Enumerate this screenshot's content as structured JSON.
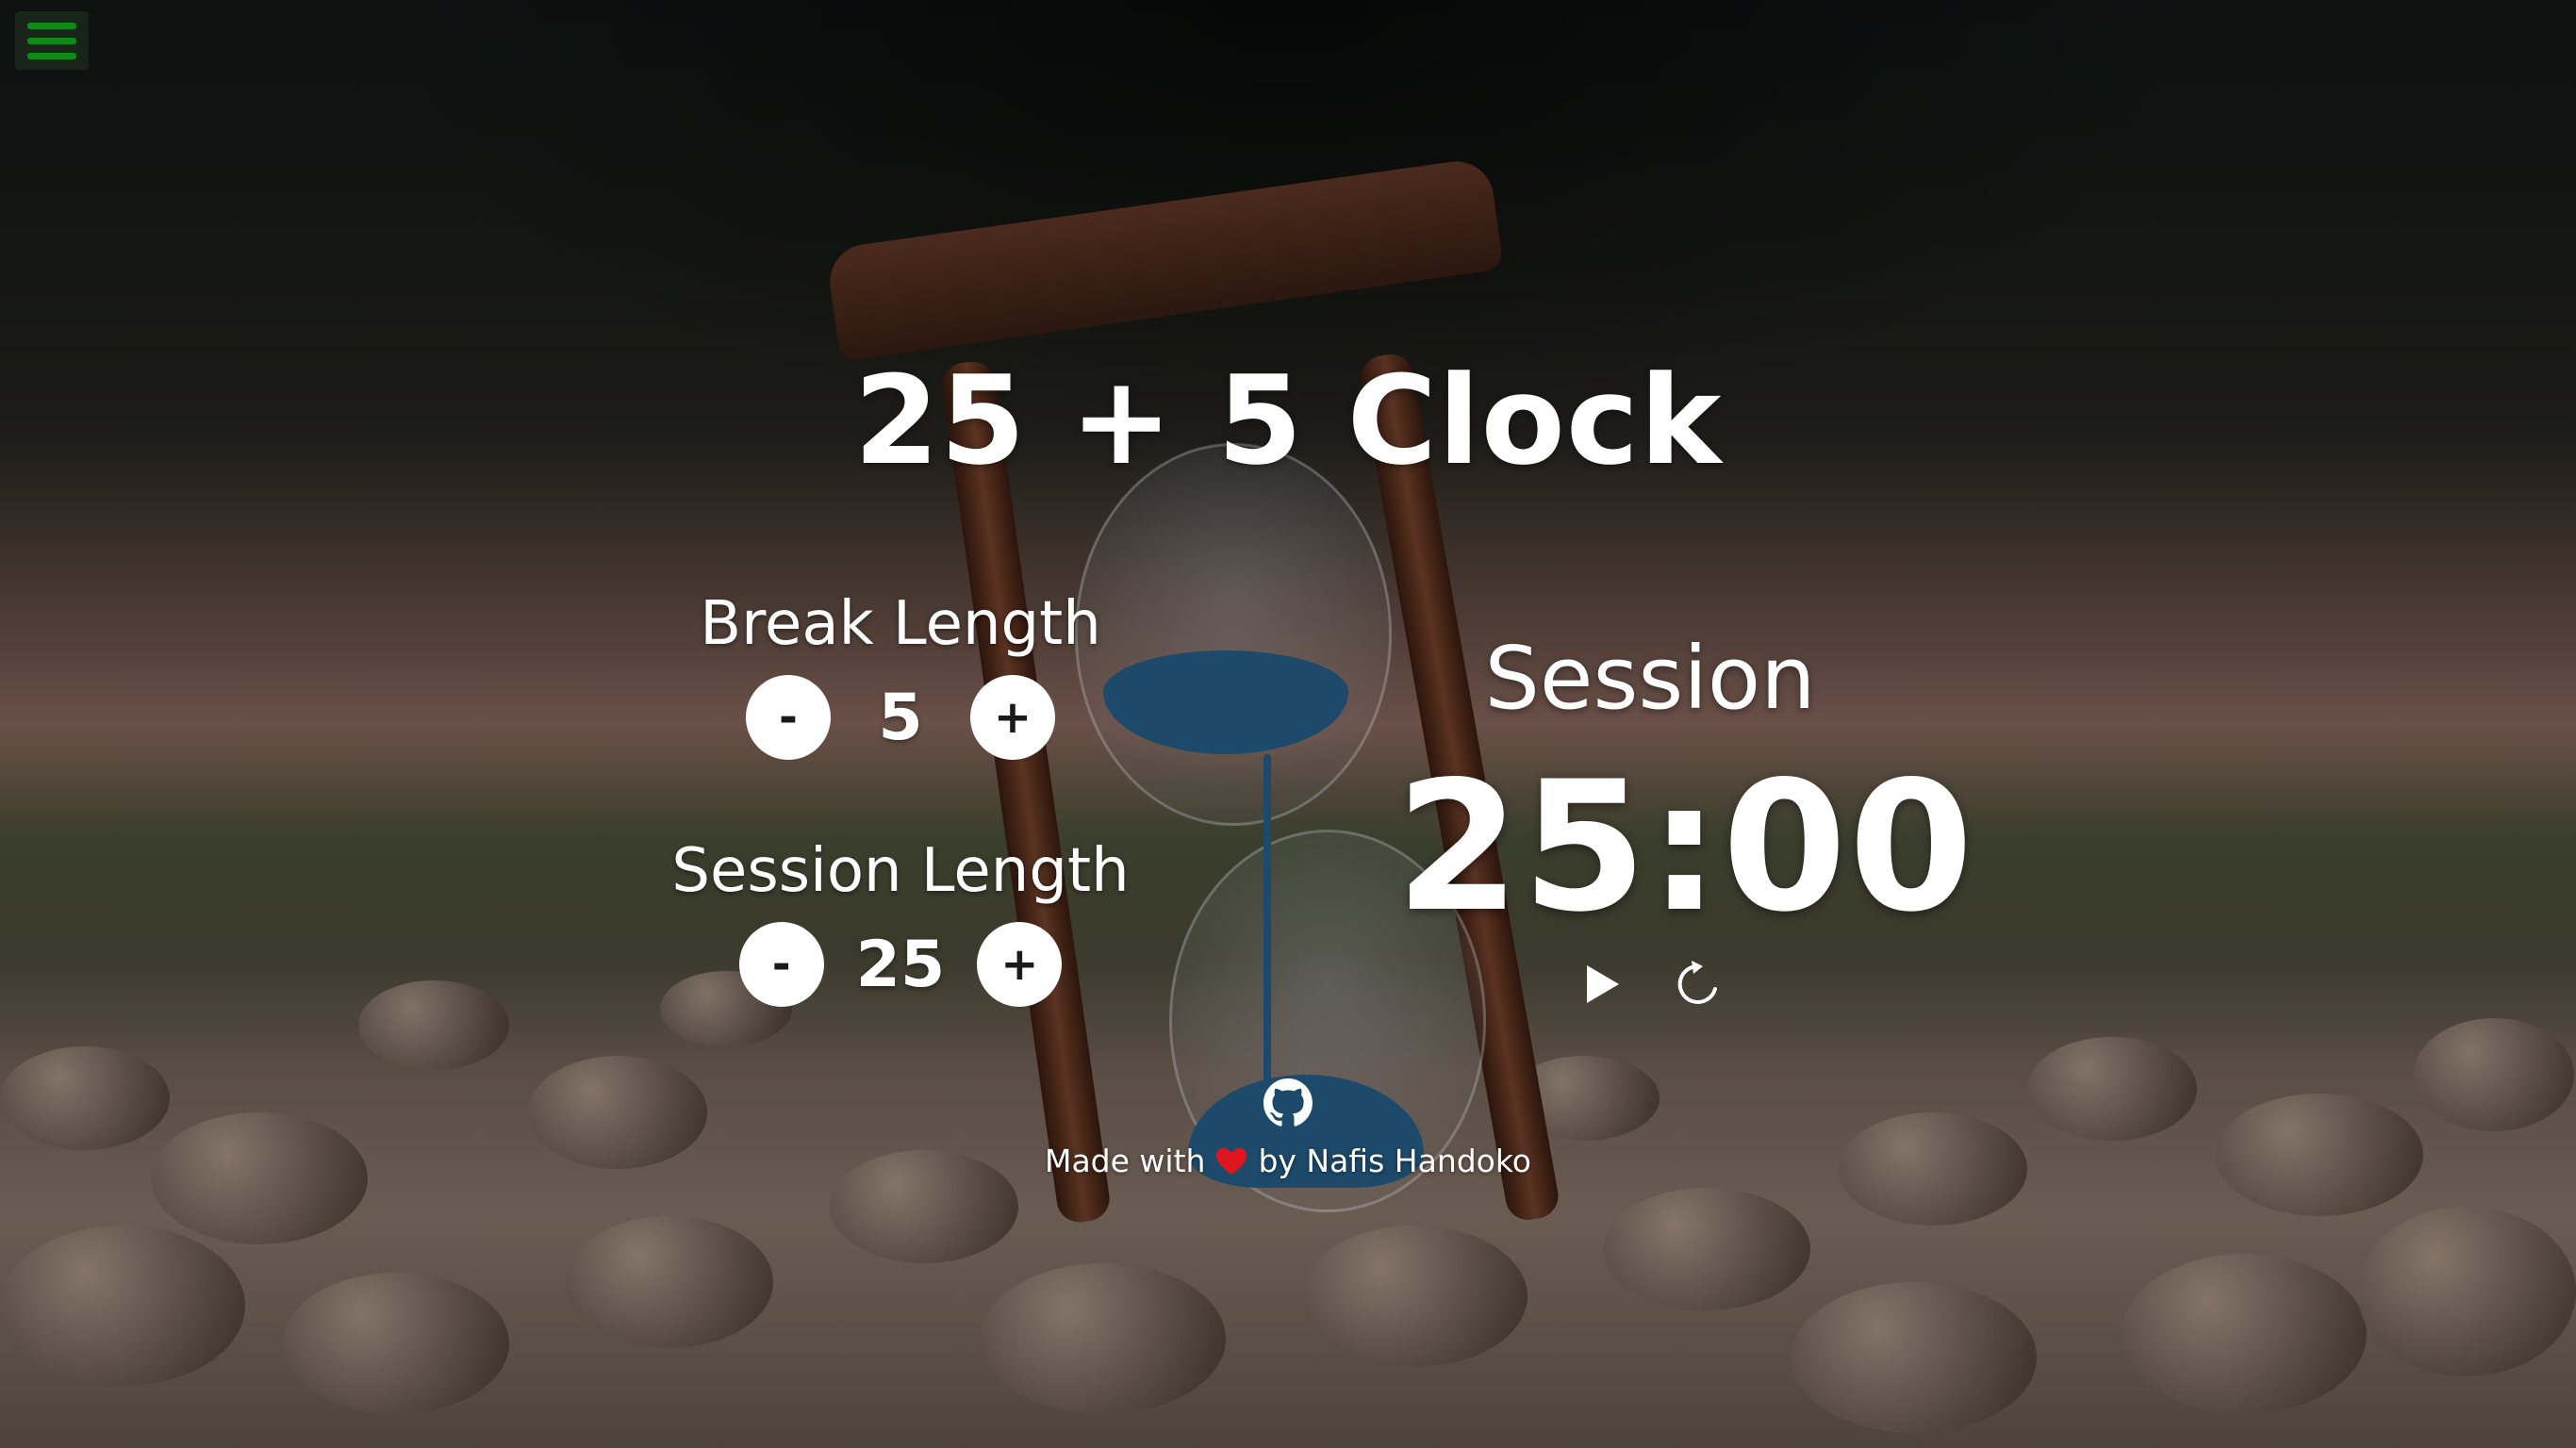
{
  "app": {
    "title": "25 + 5 Clock"
  },
  "menu": {
    "icon": "hamburger-menu-icon",
    "color": "#0f8a16"
  },
  "break_control": {
    "label": "Break Length",
    "decrement_label": "-",
    "value": "5",
    "increment_label": "+"
  },
  "session_control": {
    "label": "Session Length",
    "decrement_label": "-",
    "value": "25",
    "increment_label": "+"
  },
  "timer": {
    "label": "Session",
    "display": "25:00",
    "play_icon": "play-icon",
    "reset_icon": "reset-icon"
  },
  "footer": {
    "github_icon": "github-icon",
    "made_with": "Made with",
    "heart_icon": "heart-icon",
    "heart_color": "#e0161e",
    "author": "by Nafis Handoko"
  }
}
